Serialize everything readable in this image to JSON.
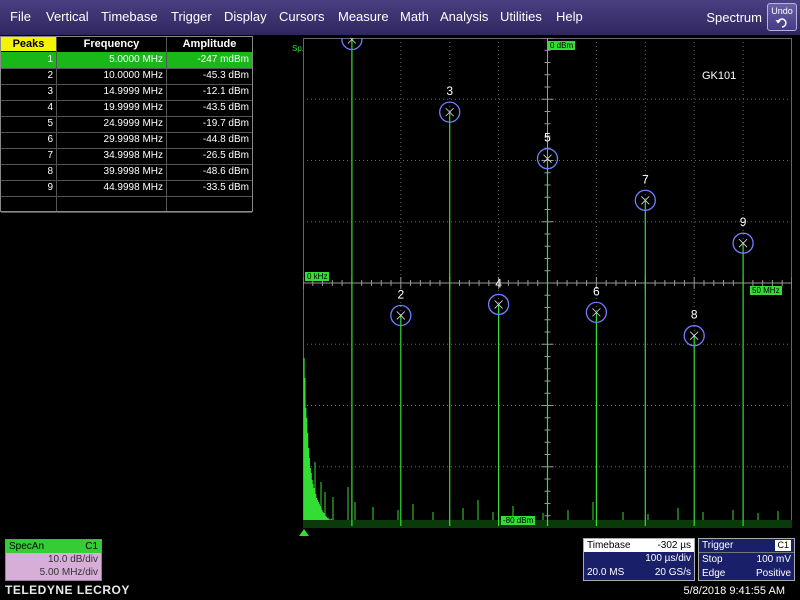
{
  "menu": {
    "items": [
      "File",
      "Vertical",
      "Timebase",
      "Trigger",
      "Display",
      "Cursors",
      "Measure",
      "Math",
      "Analysis",
      "Utilities",
      "Help"
    ],
    "mode": "Spectrum",
    "undo_label": "Undo",
    "undo_icon": "undo-arrow-icon"
  },
  "peaks_table": {
    "headers": {
      "peaks": "Peaks",
      "frequency": "Frequency",
      "amplitude": "Amplitude"
    },
    "rows": [
      {
        "n": "1",
        "freq": "5.0000 MHz",
        "amp": "-247 mdBm"
      },
      {
        "n": "2",
        "freq": "10.0000 MHz",
        "amp": "-45.3 dBm"
      },
      {
        "n": "3",
        "freq": "14.9999 MHz",
        "amp": "-12.1 dBm"
      },
      {
        "n": "4",
        "freq": "19.9999 MHz",
        "amp": "-43.5 dBm"
      },
      {
        "n": "5",
        "freq": "24.9999 MHz",
        "amp": "-19.7 dBm"
      },
      {
        "n": "6",
        "freq": "29.9998 MHz",
        "amp": "-44.8 dBm"
      },
      {
        "n": "7",
        "freq": "34.9998 MHz",
        "amp": "-26.5 dBm"
      },
      {
        "n": "8",
        "freq": "39.9998 MHz",
        "amp": "-48.6 dBm"
      },
      {
        "n": "9",
        "freq": "44.9998 MHz",
        "amp": "-33.5 dBm"
      }
    ],
    "selected_row": 0
  },
  "plot": {
    "trace_label": "Sp.",
    "annotation": "GK101",
    "top_label": "0 dBm",
    "bottom_label": "-80 dBm",
    "left_label": "0 kHz",
    "right_label": "50 MHz",
    "color_trace": "#33dd33",
    "color_marker": "#6f7fff"
  },
  "chart_data": {
    "type": "line",
    "x_range_mhz": [
      0,
      50
    ],
    "y_range_dbm": [
      -80,
      0
    ],
    "peaks": [
      {
        "label": "1",
        "x": 5.0,
        "y": -0.247
      },
      {
        "label": "2",
        "x": 10.0,
        "y": -45.3
      },
      {
        "label": "3",
        "x": 15.0,
        "y": -12.1
      },
      {
        "label": "4",
        "x": 20.0,
        "y": -43.5
      },
      {
        "label": "5",
        "x": 25.0,
        "y": -19.7
      },
      {
        "label": "6",
        "x": 30.0,
        "y": -44.8
      },
      {
        "label": "7",
        "x": 35.0,
        "y": -26.5
      },
      {
        "label": "8",
        "x": 40.0,
        "y": -48.6
      },
      {
        "label": "9",
        "x": 45.0,
        "y": -33.5
      }
    ]
  },
  "specan": {
    "title": "SpecAn",
    "channel": "C1",
    "scale": "10.0 dB/div",
    "span": "5.00 MHz/div"
  },
  "brand": "TELEDYNE LECROY",
  "timebase": {
    "title": "Timebase",
    "delay": "-302 µs",
    "per_div": "100 µs/div",
    "samples": "20.0 MS",
    "rate": "20 GS/s"
  },
  "trigger": {
    "title": "Trigger",
    "channel": "C1",
    "mode": "Stop",
    "level": "100 mV",
    "type": "Edge",
    "slope": "Positive"
  },
  "datetime": "5/8/2018 9:41:55 AM"
}
